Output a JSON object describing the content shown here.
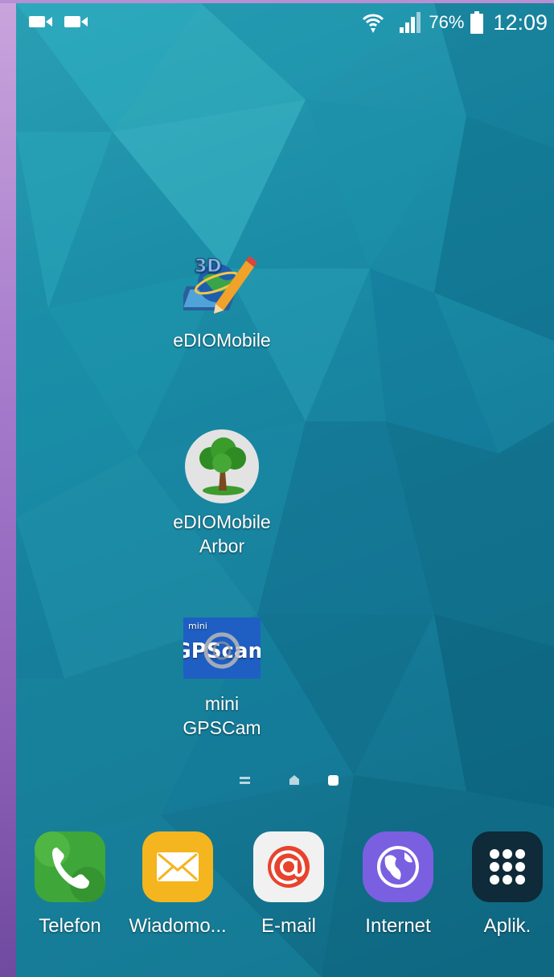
{
  "status_bar": {
    "left_icons": [
      "video-camera-icon",
      "video-camera-icon"
    ],
    "right_icons": [
      "wifi-icon",
      "signal-icon",
      "battery-icon"
    ],
    "battery_percent": "76%",
    "time": "12:09"
  },
  "home_screen": {
    "apps": [
      {
        "label_lines": [
          "eDIOMobile"
        ],
        "icon": "ediomobile-icon"
      },
      {
        "label_lines": [
          "eDIOMobile",
          "Arbor"
        ],
        "icon": "tree-icon"
      },
      {
        "label_lines": [
          "mini",
          "GPSCam"
        ],
        "icon": "gpscam-icon",
        "icon_text_small": "mini",
        "icon_text": "GPScam"
      }
    ],
    "page_indicator": [
      "menu-icon",
      "home-icon",
      "page-dot-icon"
    ],
    "current_page": 3
  },
  "dock": {
    "apps": [
      {
        "label": "Telefon",
        "icon": "phone-icon",
        "color": "#3fa63a"
      },
      {
        "label": "Wiadomo...",
        "icon": "envelope-icon",
        "color": "#f4b51e"
      },
      {
        "label": "E-mail",
        "icon": "at-icon",
        "color": "#e8432d"
      },
      {
        "label": "Internet",
        "icon": "globe-icon",
        "color": "#7a5fe0"
      },
      {
        "label": "Aplik.",
        "icon": "apps-grid-icon",
        "color": "#0f2a38"
      }
    ]
  },
  "colors": {
    "wallpaper": "#1a8ca6",
    "frame": "#a57acb"
  }
}
